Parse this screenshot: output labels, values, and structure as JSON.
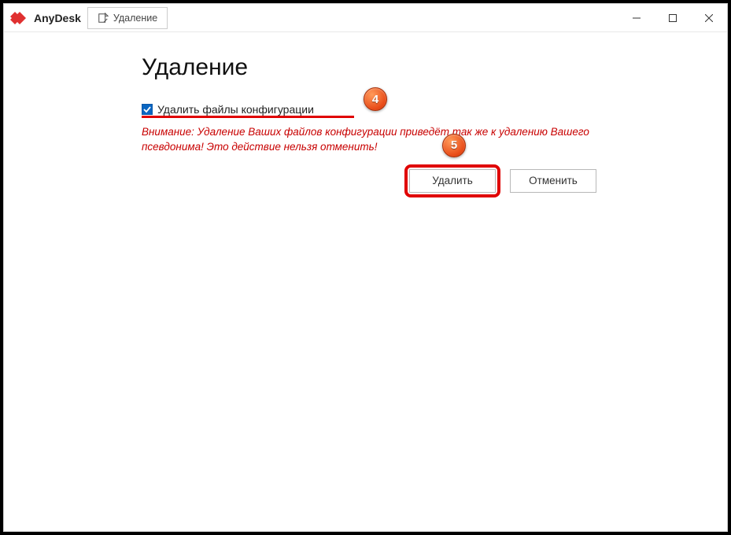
{
  "app": {
    "name": "AnyDesk"
  },
  "tab": {
    "label": "Удаление"
  },
  "page": {
    "title": "Удаление"
  },
  "checkbox": {
    "label": "Удалить файлы конфигурации",
    "checked": true
  },
  "warning": {
    "text": "Внимание: Удаление Ваших файлов конфигурации приведёт так же к удалению Вашего псевдонима! Это действие нельзя отменить!"
  },
  "buttons": {
    "delete": "Удалить",
    "cancel": "Отменить"
  },
  "annotations": {
    "step4": "4",
    "step5": "5"
  }
}
